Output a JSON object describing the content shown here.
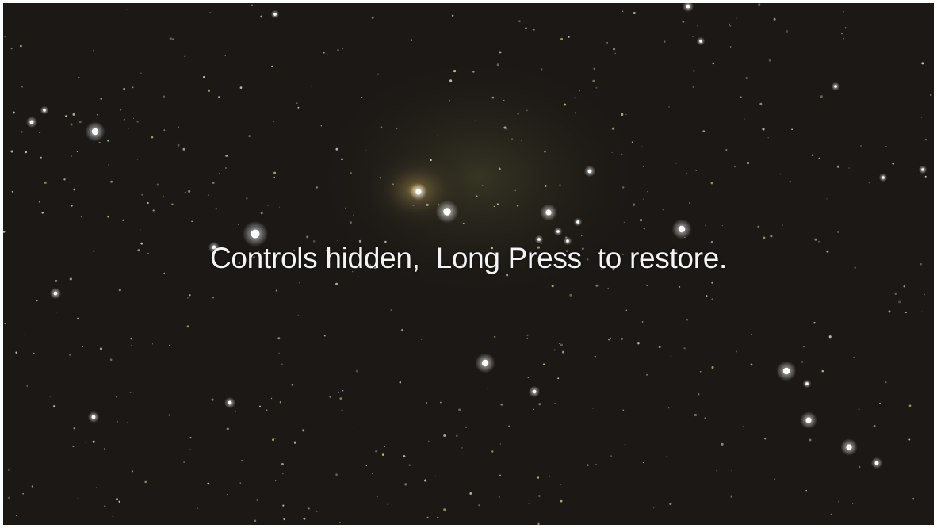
{
  "screen": {
    "background_description": "",
    "message": "Controls hidden,  Long Press  to restore."
  },
  "colors": {
    "sky_base": "#1a1714",
    "text": "#f4f4f4",
    "nebula_glow": "#c9a85a",
    "star_white": "#ffffff",
    "star_warm": "#f3dfae"
  }
}
